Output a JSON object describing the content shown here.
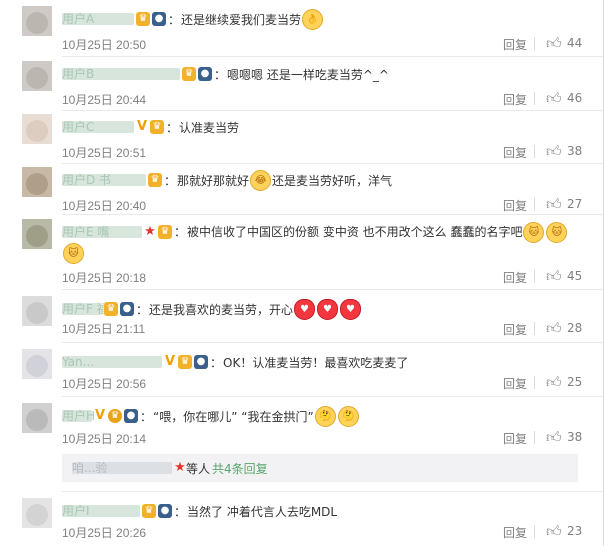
{
  "comments": [
    {
      "user": "用户A",
      "text": "还是继续爱我们麦当劳",
      "emojis": [
        "ok"
      ],
      "time": "10月25日 20:50",
      "reply": "回复",
      "likes": "44"
    },
    {
      "user": "用户B",
      "text": "嗯嗯嗯 还是一样吃麦当劳^_^",
      "emojis": [],
      "time": "10月25日 20:44",
      "reply": "回复",
      "likes": "46"
    },
    {
      "user": "用户C",
      "text": "认准麦当劳",
      "emojis": [],
      "time": "10月25日 20:51",
      "reply": "回复",
      "likes": "38"
    },
    {
      "user": "用户D 书",
      "text_before": "那就好那就好",
      "text_after": "还是麦当劳好听，洋气",
      "emojis": [
        "laugh"
      ],
      "time": "10月25日 20:40",
      "reply": "回复",
      "likes": "27"
    },
    {
      "user": "用户E 嘴",
      "text": "被中信收了中国区的份额 变中资 也不用改个这么 蠢蠢的名字吧",
      "emojis": [
        "cat",
        "cat",
        "cat"
      ],
      "time": "10月25日 20:18",
      "reply": "回复",
      "likes": "45"
    },
    {
      "user": "用户F 福",
      "text": "还是我喜欢的麦当劳，开心",
      "emojis": [
        "heart",
        "heart",
        "heart"
      ],
      "time": "10月25日 21:11",
      "reply": "回复",
      "likes": "28"
    },
    {
      "user": "Yan...",
      "text": "OK！认准麦当劳！最喜欢吃麦麦了",
      "emojis": [],
      "time": "10月25日 20:56",
      "reply": "回复",
      "likes": "25"
    },
    {
      "user": "用户H",
      "text": "“喂，你在哪儿” “我在金拱门”",
      "emojis": [
        "think",
        "think"
      ],
      "time": "10月25日 20:14",
      "reply": "回复",
      "likes": "38"
    },
    {
      "user": "用户I",
      "text": "当然了 冲着代言人去吃MDL",
      "emojis": [],
      "time": "10月25日 20:26",
      "reply": "回复",
      "likes": "23"
    }
  ],
  "more_replies": {
    "who": "咱...验",
    "suffix": "等人",
    "count": "共4条回复"
  },
  "icons": {
    "like": "thumbs-up-icon",
    "crown": "crown-badge-icon",
    "star": "red-star-icon",
    "verified": "orange-v-icon"
  },
  "colors": {
    "link": "#eb7350",
    "meta": "#808080"
  }
}
